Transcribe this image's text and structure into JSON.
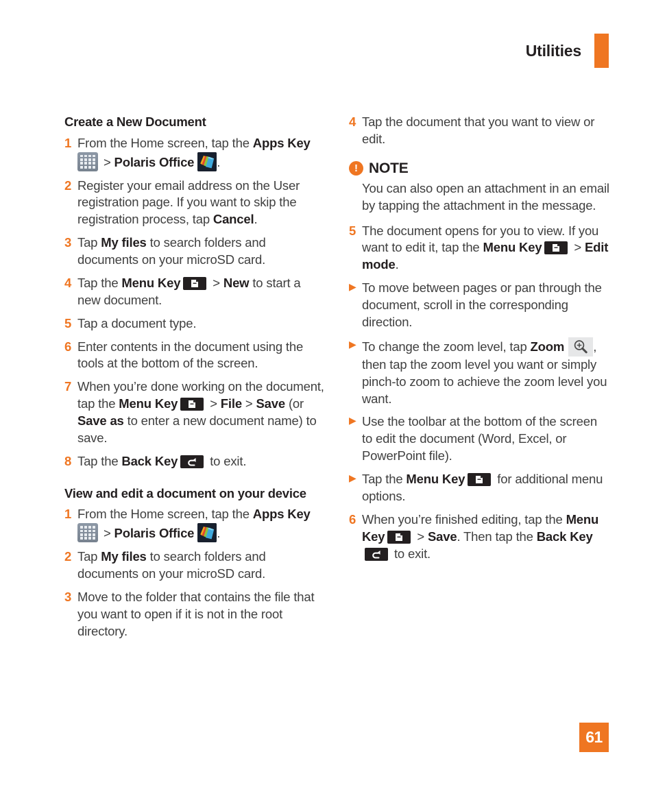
{
  "header": {
    "title": "Utilities",
    "accent_color": "#ef7622",
    "bar_name": "header-accent-bar"
  },
  "page_number": "61",
  "left_column": {
    "section1_heading": "Create a New Document",
    "steps": [
      {
        "num": "1",
        "parts": [
          {
            "t": "From the Home screen, tap the "
          },
          {
            "t": "Apps Key",
            "b": true
          },
          {
            "t": " ",
            "icon": "apps-key-icon"
          },
          {
            "t": " > "
          },
          {
            "t": "Polaris Office",
            "b": true
          },
          {
            "t": " ",
            "icon": "polaris-office-icon"
          },
          {
            "t": "."
          }
        ]
      },
      {
        "num": "2",
        "parts": [
          {
            "t": "Register your email address on the User registration page. If you want to skip the registration process, tap "
          },
          {
            "t": "Cancel",
            "b": true
          },
          {
            "t": "."
          }
        ]
      },
      {
        "num": "3",
        "parts": [
          {
            "t": "Tap "
          },
          {
            "t": "My files",
            "b": true
          },
          {
            "t": " to search folders and documents on your microSD card."
          }
        ]
      },
      {
        "num": "4",
        "parts": [
          {
            "t": "Tap the "
          },
          {
            "t": "Menu Key",
            "b": true
          },
          {
            "t": " ",
            "icon": "menu-key-icon"
          },
          {
            "t": " > "
          },
          {
            "t": "New",
            "b": true
          },
          {
            "t": " to start a new document."
          }
        ]
      },
      {
        "num": "5",
        "parts": [
          {
            "t": "Tap a document type."
          }
        ]
      },
      {
        "num": "6",
        "parts": [
          {
            "t": "Enter contents in the document using the tools at the bottom of the screen."
          }
        ]
      },
      {
        "num": "7",
        "parts": [
          {
            "t": "When you’re done working on the document, tap the "
          },
          {
            "t": "Menu Key",
            "b": true
          },
          {
            "t": " ",
            "icon": "menu-key-icon"
          },
          {
            "t": " > "
          },
          {
            "t": "File",
            "b": true
          },
          {
            "t": " > "
          },
          {
            "t": "Save",
            "b": true
          },
          {
            "t": " (or "
          },
          {
            "t": "Save as",
            "b": true
          },
          {
            "t": " to enter a new document name) to save."
          }
        ]
      },
      {
        "num": "8",
        "parts": [
          {
            "t": "Tap the "
          },
          {
            "t": "Back Key",
            "b": true
          },
          {
            "t": " ",
            "icon": "back-key-icon"
          },
          {
            "t": " to exit."
          }
        ]
      }
    ],
    "section2_heading": "View and edit a document on your device",
    "steps2": [
      {
        "num": "1",
        "parts": [
          {
            "t": "From the Home screen, tap the "
          },
          {
            "t": "Apps Key",
            "b": true
          },
          {
            "t": " ",
            "icon": "apps-key-icon"
          },
          {
            "t": " > "
          },
          {
            "t": "Polaris Office",
            "b": true
          },
          {
            "t": " ",
            "icon": "polaris-office-icon"
          },
          {
            "t": "."
          }
        ]
      },
      {
        "num": "2",
        "parts": [
          {
            "t": "Tap "
          },
          {
            "t": "My files",
            "b": true
          },
          {
            "t": " to search folders and documents on your microSD card."
          }
        ]
      },
      {
        "num": "3",
        "parts": [
          {
            "t": "Move to the folder that contains the file that you want to open if it is not in the root directory."
          }
        ]
      }
    ]
  },
  "right_column": {
    "steps_top": [
      {
        "num": "4",
        "parts": [
          {
            "t": "Tap the document that you want to view or edit."
          }
        ]
      }
    ],
    "note": {
      "icon": "note-exclamation-icon",
      "badge": "!",
      "title": "NOTE",
      "body": "You can also open an attachment in an email by tapping the attachment in the message."
    },
    "steps_mid": [
      {
        "num": "5",
        "parts": [
          {
            "t": "The document opens for you to view. If you want to edit it, tap the "
          },
          {
            "t": "Menu Key",
            "b": true
          },
          {
            "t": " ",
            "icon": "menu-key-icon"
          },
          {
            "t": " > "
          },
          {
            "t": "Edit mode",
            "b": true
          },
          {
            "t": "."
          }
        ]
      }
    ],
    "bullets": [
      {
        "marker": "▶",
        "parts": [
          {
            "t": "To move between pages or pan through the document, scroll in the corresponding direction."
          }
        ]
      },
      {
        "marker": "▶",
        "parts": [
          {
            "t": "To change the zoom level, tap "
          },
          {
            "t": "Zoom",
            "b": true
          },
          {
            "t": " ",
            "icon": "zoom-in-icon"
          },
          {
            "t": ", then tap the zoom level you want or simply pinch-to zoom to achieve the zoom level you want."
          }
        ]
      },
      {
        "marker": "▶",
        "parts": [
          {
            "t": "Use the toolbar at the bottom of the screen to edit the document (Word, Excel, or PowerPoint file)."
          }
        ]
      },
      {
        "marker": "▶",
        "parts": [
          {
            "t": "Tap the "
          },
          {
            "t": "Menu Key",
            "b": true
          },
          {
            "t": " ",
            "icon": "menu-key-icon"
          },
          {
            "t": " for additional menu options."
          }
        ]
      }
    ],
    "steps_bottom": [
      {
        "num": "6",
        "parts": [
          {
            "t": "When you’re finished editing, tap the "
          },
          {
            "t": "Menu",
            "b": true
          },
          {
            "t": " "
          },
          {
            "t": "Key",
            "b": true
          },
          {
            "t": " ",
            "icon": "menu-key-icon"
          },
          {
            "t": " > "
          },
          {
            "t": "Save",
            "b": true
          },
          {
            "t": ". Then tap the "
          },
          {
            "t": "Back Key",
            "b": true
          },
          {
            "t": " ",
            "icon": "back-key-icon"
          },
          {
            "t": " to exit."
          }
        ]
      }
    ]
  }
}
